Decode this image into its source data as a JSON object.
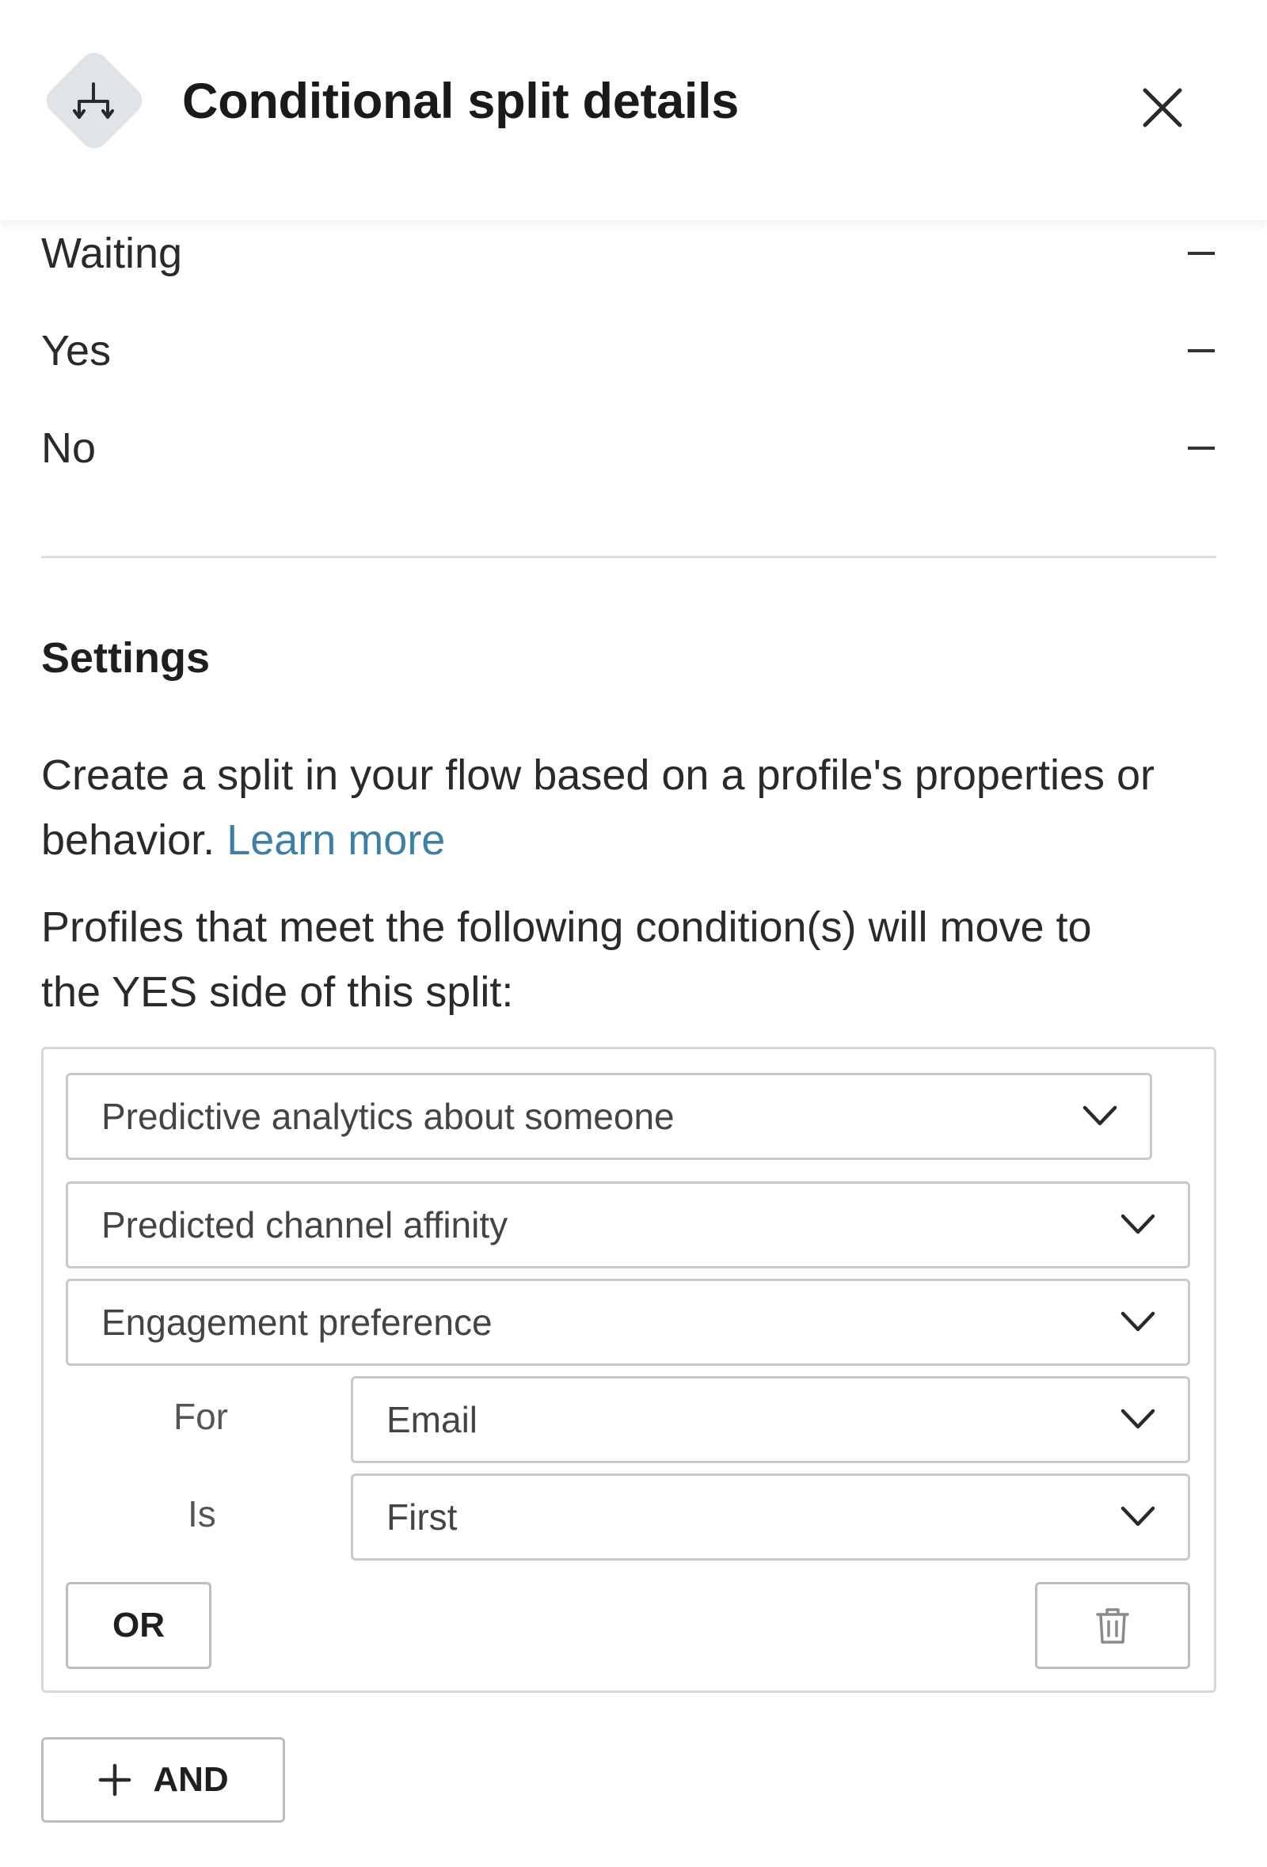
{
  "header": {
    "title": "Conditional split details",
    "icon": "conditional-split-icon",
    "close_icon": "close-icon"
  },
  "status": {
    "rows": [
      {
        "label": "Waiting",
        "value": "–"
      },
      {
        "label": "Yes",
        "value": "–"
      },
      {
        "label": "No",
        "value": "–"
      }
    ]
  },
  "settings": {
    "title": "Settings",
    "description_line1": "Create a split in your flow based on a profile's properties or",
    "description_line2": "behavior.",
    "learn_more": "Learn more",
    "condition_intro_line1": "Profiles that meet the following condition(s) will move to",
    "condition_intro_line2": "the YES side of this split:"
  },
  "condition": {
    "category": "Predictive analytics about someone",
    "metric": "Predicted channel affinity",
    "property": "Engagement preference",
    "for_label": "For",
    "for_value": "Email",
    "is_label": "Is",
    "is_value": "First",
    "or_button": "OR",
    "delete_icon": "trash-icon"
  },
  "actions": {
    "and_button": "AND",
    "and_icon": "plus-icon"
  },
  "colors": {
    "link": "#3d7fa6",
    "icon_bg": "#dfe4e8",
    "border": "#c9c9c9"
  }
}
